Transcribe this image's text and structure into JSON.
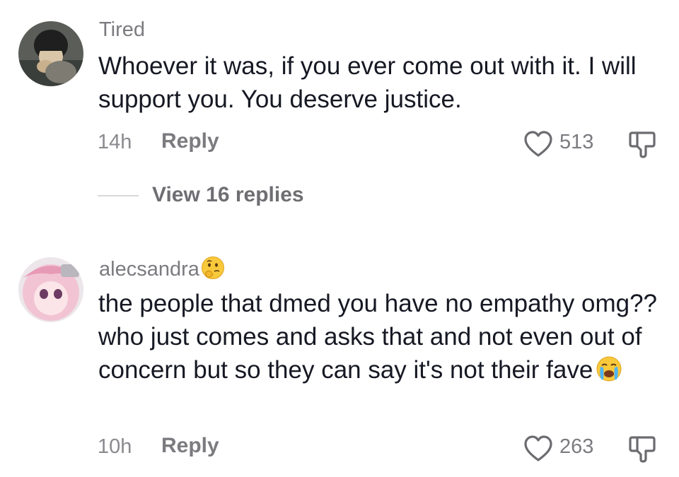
{
  "comments": [
    {
      "username": "Tired",
      "text": "Whoever it was, if you ever come out with it. I will support you. You deserve justice.",
      "time": "14h",
      "reply_label": "Reply",
      "likes": "513",
      "username_emoji": "",
      "text_emoji": "",
      "view_replies": "View 16 replies"
    },
    {
      "username": "alecsandra",
      "username_emoji": "thinking-face-emoji",
      "text": "the people that dmed you have no empathy omg?? who just comes and asks that and not even out of concern but so they can say it's not their fave",
      "text_emoji": "loudly-crying-face-emoji",
      "time": "10h",
      "reply_label": "Reply",
      "likes": "263"
    }
  ],
  "icons": {
    "like": "heart-outline-icon",
    "dislike": "thumbs-down-icon"
  },
  "colors": {
    "text": "#161823",
    "muted": "#7b7b80",
    "divider": "#d8d8dc"
  }
}
